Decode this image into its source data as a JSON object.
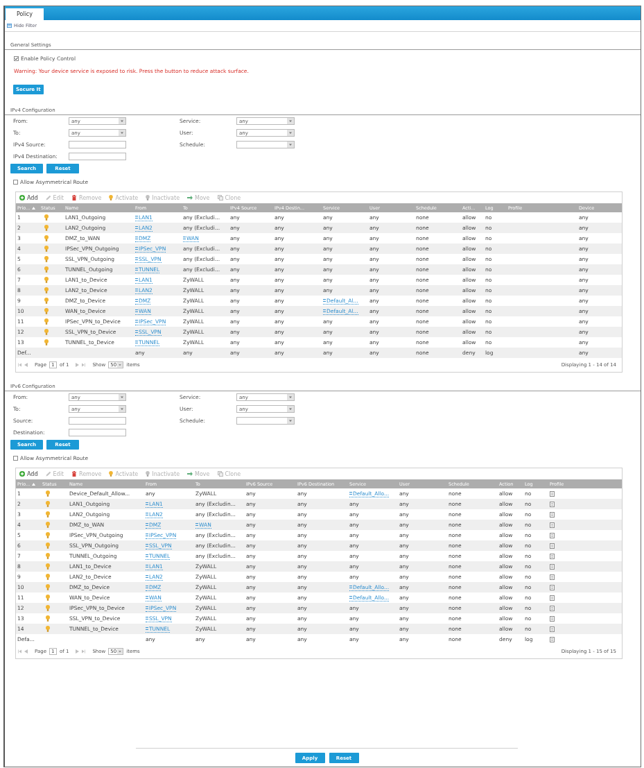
{
  "tabs": [
    {
      "label": "Policy",
      "selected": true
    }
  ],
  "filter_toggle": {
    "label": "Hide Filter"
  },
  "general_settings": {
    "title": "General Settings",
    "enable_policy_control": {
      "label": "Enable Policy Control",
      "checked": true
    },
    "warning": "Warning: Your device service is exposed to risk. Press the button to reduce attack surface.",
    "secure_button": "Secure It"
  },
  "ipv4": {
    "title": "IPv4 Configuration",
    "filters_left": [
      {
        "label": "From:",
        "kind": "select",
        "value": "any"
      },
      {
        "label": "To:",
        "kind": "select",
        "value": "any"
      },
      {
        "label": "IPv4 Source:",
        "kind": "text"
      },
      {
        "label": "IPv4 Destination:",
        "kind": "text"
      }
    ],
    "filters_right": [
      {
        "label": "Service:",
        "kind": "select",
        "value": "any"
      },
      {
        "label": "User:",
        "kind": "select",
        "value": "any"
      },
      {
        "label": "Schedule:",
        "kind": "select"
      }
    ],
    "buttons": [
      "Search",
      "Reset"
    ],
    "asymmetrical_route": {
      "label": "Allow Asymmetrical Route",
      "checked": false
    },
    "toolbar": [
      {
        "kind": "add",
        "label": "Add",
        "disabled": false
      },
      {
        "kind": "edit",
        "label": "Edit",
        "disabled": true
      },
      {
        "kind": "remove",
        "label": "Remove",
        "disabled": true
      },
      {
        "kind": "activate",
        "label": "Activate",
        "disabled": true
      },
      {
        "kind": "inactivate",
        "label": "Inactivate",
        "disabled": true
      },
      {
        "kind": "move",
        "label": "Move",
        "disabled": true
      },
      {
        "kind": "clone",
        "label": "Clone",
        "disabled": true
      }
    ],
    "table": {
      "columns": [
        {
          "label": "Prio...",
          "sorted": true
        },
        {
          "label": "Status",
          "sorted": false
        },
        {
          "label": "Name",
          "sorted": false
        },
        {
          "label": "From",
          "sorted": false
        },
        {
          "label": "To",
          "sorted": false
        },
        {
          "label": "IPv4 Source",
          "sorted": false
        },
        {
          "label": "IPv4 Destin...",
          "sorted": false
        },
        {
          "label": "Service",
          "sorted": false
        },
        {
          "label": "User",
          "sorted": false
        },
        {
          "label": "Schedule",
          "sorted": false
        },
        {
          "label": "Acti...",
          "sorted": false
        },
        {
          "label": "Log",
          "sorted": false
        },
        {
          "label": "Profile",
          "sorted": false
        },
        {
          "label": "Device",
          "sorted": false
        }
      ],
      "rows": [
        {
          "priority": "1",
          "active": true,
          "name": "LAN1_Outgoing",
          "from": {
            "kind": "object",
            "text": "LAN1"
          },
          "to": "any (Excludi...",
          "source": "any",
          "destination": "any",
          "service": "any",
          "user": "any",
          "schedule": "none",
          "action": "allow",
          "log": "no",
          "device": "any"
        },
        {
          "priority": "2",
          "active": true,
          "name": "LAN2_Outgoing",
          "from": {
            "kind": "object",
            "text": "LAN2"
          },
          "to": "any (Excludi...",
          "source": "any",
          "destination": "any",
          "service": "any",
          "user": "any",
          "schedule": "none",
          "action": "allow",
          "log": "no",
          "device": "any"
        },
        {
          "priority": "3",
          "active": true,
          "name": "DMZ_to_WAN",
          "from": {
            "kind": "object",
            "text": "DMZ"
          },
          "to": {
            "kind": "object",
            "text": "WAN"
          },
          "source": "any",
          "destination": "any",
          "service": "any",
          "user": "any",
          "schedule": "none",
          "action": "allow",
          "log": "no",
          "device": "any"
        },
        {
          "priority": "4",
          "active": true,
          "name": "IPSec_VPN_Outgoing",
          "from": {
            "kind": "object",
            "text": "IPSec_VPN"
          },
          "to": "any (Excludi...",
          "source": "any",
          "destination": "any",
          "service": "any",
          "user": "any",
          "schedule": "none",
          "action": "allow",
          "log": "no",
          "device": "any"
        },
        {
          "priority": "5",
          "active": true,
          "name": "SSL_VPN_Outgoing",
          "from": {
            "kind": "object",
            "text": "SSL_VPN"
          },
          "to": "any (Excludi...",
          "source": "any",
          "destination": "any",
          "service": "any",
          "user": "any",
          "schedule": "none",
          "action": "allow",
          "log": "no",
          "device": "any"
        },
        {
          "priority": "6",
          "active": true,
          "name": "TUNNEL_Outgoing",
          "from": {
            "kind": "object",
            "text": "TUNNEL"
          },
          "to": "any (Excludi...",
          "source": "any",
          "destination": "any",
          "service": "any",
          "user": "any",
          "schedule": "none",
          "action": "allow",
          "log": "no",
          "device": "any"
        },
        {
          "priority": "7",
          "active": true,
          "name": "LAN1_to_Device",
          "from": {
            "kind": "object",
            "text": "LAN1"
          },
          "to": "ZyWALL",
          "source": "any",
          "destination": "any",
          "service": "any",
          "user": "any",
          "schedule": "none",
          "action": "allow",
          "log": "no",
          "device": "any"
        },
        {
          "priority": "8",
          "active": true,
          "name": "LAN2_to_Device",
          "from": {
            "kind": "object",
            "text": "LAN2"
          },
          "to": "ZyWALL",
          "source": "any",
          "destination": "any",
          "service": "any",
          "user": "any",
          "schedule": "none",
          "action": "allow",
          "log": "no",
          "device": "any"
        },
        {
          "priority": "9",
          "active": true,
          "name": "DMZ_to_Device",
          "from": {
            "kind": "object",
            "text": "DMZ"
          },
          "to": "ZyWALL",
          "source": "any",
          "destination": "any",
          "service": {
            "kind": "object",
            "text": "Default_Al..."
          },
          "user": "any",
          "schedule": "none",
          "action": "allow",
          "log": "no",
          "device": "any"
        },
        {
          "priority": "10",
          "active": true,
          "name": "WAN_to_Device",
          "from": {
            "kind": "object",
            "text": "WAN"
          },
          "to": "ZyWALL",
          "source": "any",
          "destination": "any",
          "service": {
            "kind": "object",
            "text": "Default_Al..."
          },
          "user": "any",
          "schedule": "none",
          "action": "allow",
          "log": "no",
          "device": "any"
        },
        {
          "priority": "11",
          "active": true,
          "name": "IPSec_VPN_to_Device",
          "from": {
            "kind": "object",
            "text": "IPSec_VPN"
          },
          "to": "ZyWALL",
          "source": "any",
          "destination": "any",
          "service": "any",
          "user": "any",
          "schedule": "none",
          "action": "allow",
          "log": "no",
          "device": "any"
        },
        {
          "priority": "12",
          "active": true,
          "name": "SSL_VPN_to_Device",
          "from": {
            "kind": "object",
            "text": "SSL_VPN"
          },
          "to": "ZyWALL",
          "source": "any",
          "destination": "any",
          "service": "any",
          "user": "any",
          "schedule": "none",
          "action": "allow",
          "log": "no",
          "device": "any"
        },
        {
          "priority": "13",
          "active": true,
          "name": "TUNNEL_to_Device",
          "from": {
            "kind": "object",
            "text": "TUNNEL"
          },
          "to": "ZyWALL",
          "source": "any",
          "destination": "any",
          "service": "any",
          "user": "any",
          "schedule": "none",
          "action": "allow",
          "log": "no",
          "device": "any"
        },
        {
          "priority": "Def...",
          "active": false,
          "from": "any",
          "to": "any",
          "source": "any",
          "destination": "any",
          "service": "any",
          "user": "any",
          "schedule": "none",
          "action": "deny",
          "log": "log",
          "device": "any"
        }
      ]
    },
    "pagination": {
      "page_label": "Page",
      "page": "1",
      "page_count": "of 1",
      "show_label": "Show",
      "page_size": "50",
      "items_label": "items",
      "summary": "Displaying 1 - 14 of 14"
    }
  },
  "ipv6": {
    "title": "IPv6 Configuration",
    "filters_left": [
      {
        "label": "From:",
        "kind": "select",
        "value": "any"
      },
      {
        "label": "To:",
        "kind": "select",
        "value": "any"
      },
      {
        "label": "Source:",
        "kind": "text"
      },
      {
        "label": "Destination:",
        "kind": "text"
      }
    ],
    "filters_right": [
      {
        "label": "Service:",
        "kind": "select",
        "value": "any"
      },
      {
        "label": "User:",
        "kind": "select",
        "value": "any"
      },
      {
        "label": "Schedule:",
        "kind": "select"
      }
    ],
    "buttons": [
      "Search",
      "Reset"
    ],
    "asymmetrical_route": {
      "label": "Allow Asymmetrical Route",
      "checked": false
    },
    "toolbar": [
      {
        "kind": "add",
        "label": "Add",
        "disabled": false
      },
      {
        "kind": "edit",
        "label": "Edit",
        "disabled": true
      },
      {
        "kind": "remove",
        "label": "Remove",
        "disabled": true
      },
      {
        "kind": "activate",
        "label": "Activate",
        "disabled": true
      },
      {
        "kind": "inactivate",
        "label": "Inactivate",
        "disabled": true
      },
      {
        "kind": "move",
        "label": "Move",
        "disabled": true
      },
      {
        "kind": "clone",
        "label": "Clone",
        "disabled": true
      }
    ],
    "table": {
      "columns": [
        {
          "label": "Prio...",
          "sorted": true
        },
        {
          "label": "Status",
          "sorted": false
        },
        {
          "label": "Name",
          "sorted": false
        },
        {
          "label": "From",
          "sorted": false
        },
        {
          "label": "To",
          "sorted": false
        },
        {
          "label": "IPv6 Source",
          "sorted": false
        },
        {
          "label": "IPv6 Destination",
          "sorted": false
        },
        {
          "label": "Service",
          "sorted": false
        },
        {
          "label": "User",
          "sorted": false
        },
        {
          "label": "Schedule",
          "sorted": false
        },
        {
          "label": "Action",
          "sorted": false
        },
        {
          "label": "Log",
          "sorted": false
        },
        {
          "label": "Profile",
          "sorted": false
        }
      ],
      "rows": [
        {
          "priority": "1",
          "active": true,
          "name": "Device_Default_Allow...",
          "from": "any",
          "to": "ZyWALL",
          "source": "any",
          "destination": "any",
          "service": {
            "kind": "object",
            "text": "Default_Allo..."
          },
          "user": "any",
          "schedule": "none",
          "action": "allow",
          "log": "no",
          "profile": {
            "kind": "icon"
          }
        },
        {
          "priority": "2",
          "active": true,
          "name": "LAN1_Outgoing",
          "from": {
            "kind": "object",
            "text": "LAN1"
          },
          "to": "any (Excludin...",
          "source": "any",
          "destination": "any",
          "service": "any",
          "user": "any",
          "schedule": "none",
          "action": "allow",
          "log": "no",
          "profile": {
            "kind": "icon"
          }
        },
        {
          "priority": "3",
          "active": true,
          "name": "LAN2_Outgoing",
          "from": {
            "kind": "object",
            "text": "LAN2"
          },
          "to": "any (Excludin...",
          "source": "any",
          "destination": "any",
          "service": "any",
          "user": "any",
          "schedule": "none",
          "action": "allow",
          "log": "no",
          "profile": {
            "kind": "icon"
          }
        },
        {
          "priority": "4",
          "active": true,
          "name": "DMZ_to_WAN",
          "from": {
            "kind": "object",
            "text": "DMZ"
          },
          "to": {
            "kind": "object",
            "text": "WAN"
          },
          "source": "any",
          "destination": "any",
          "service": "any",
          "user": "any",
          "schedule": "none",
          "action": "allow",
          "log": "no",
          "profile": {
            "kind": "icon"
          }
        },
        {
          "priority": "5",
          "active": true,
          "name": "IPSec_VPN_Outgoing",
          "from": {
            "kind": "object",
            "text": "IPSec_VPN"
          },
          "to": "any (Excludin...",
          "source": "any",
          "destination": "any",
          "service": "any",
          "user": "any",
          "schedule": "none",
          "action": "allow",
          "log": "no",
          "profile": {
            "kind": "icon"
          }
        },
        {
          "priority": "6",
          "active": true,
          "name": "SSL_VPN_Outgoing",
          "from": {
            "kind": "object",
            "text": "SSL_VPN"
          },
          "to": "any (Excludin...",
          "source": "any",
          "destination": "any",
          "service": "any",
          "user": "any",
          "schedule": "none",
          "action": "allow",
          "log": "no",
          "profile": {
            "kind": "icon"
          }
        },
        {
          "priority": "7",
          "active": true,
          "name": "TUNNEL_Outgoing",
          "from": {
            "kind": "object",
            "text": "TUNNEL"
          },
          "to": "any (Excludin...",
          "source": "any",
          "destination": "any",
          "service": "any",
          "user": "any",
          "schedule": "none",
          "action": "allow",
          "log": "no",
          "profile": {
            "kind": "icon"
          }
        },
        {
          "priority": "8",
          "active": true,
          "name": "LAN1_to_Device",
          "from": {
            "kind": "object",
            "text": "LAN1"
          },
          "to": "ZyWALL",
          "source": "any",
          "destination": "any",
          "service": "any",
          "user": "any",
          "schedule": "none",
          "action": "allow",
          "log": "no",
          "profile": {
            "kind": "icon"
          }
        },
        {
          "priority": "9",
          "active": true,
          "name": "LAN2_to_Device",
          "from": {
            "kind": "object",
            "text": "LAN2"
          },
          "to": "ZyWALL",
          "source": "any",
          "destination": "any",
          "service": "any",
          "user": "any",
          "schedule": "none",
          "action": "allow",
          "log": "no",
          "profile": {
            "kind": "icon"
          }
        },
        {
          "priority": "10",
          "active": true,
          "name": "DMZ_to_Device",
          "from": {
            "kind": "object",
            "text": "DMZ"
          },
          "to": "ZyWALL",
          "source": "any",
          "destination": "any",
          "service": {
            "kind": "object",
            "text": "Default_Allo..."
          },
          "user": "any",
          "schedule": "none",
          "action": "allow",
          "log": "no",
          "profile": {
            "kind": "icon"
          }
        },
        {
          "priority": "11",
          "active": true,
          "name": "WAN_to_Device",
          "from": {
            "kind": "object",
            "text": "WAN"
          },
          "to": "ZyWALL",
          "source": "any",
          "destination": "any",
          "service": {
            "kind": "object",
            "text": "Default_Allo..."
          },
          "user": "any",
          "schedule": "none",
          "action": "allow",
          "log": "no",
          "profile": {
            "kind": "icon"
          }
        },
        {
          "priority": "12",
          "active": true,
          "name": "IPSec_VPN_to_Device",
          "from": {
            "kind": "object",
            "text": "IPSec_VPN"
          },
          "to": "ZyWALL",
          "source": "any",
          "destination": "any",
          "service": "any",
          "user": "any",
          "schedule": "none",
          "action": "allow",
          "log": "no",
          "profile": {
            "kind": "icon"
          }
        },
        {
          "priority": "13",
          "active": true,
          "name": "SSL_VPN_to_Device",
          "from": {
            "kind": "object",
            "text": "SSL_VPN"
          },
          "to": "ZyWALL",
          "source": "any",
          "destination": "any",
          "service": "any",
          "user": "any",
          "schedule": "none",
          "action": "allow",
          "log": "no",
          "profile": {
            "kind": "icon"
          }
        },
        {
          "priority": "14",
          "active": true,
          "name": "TUNNEL_to_Device",
          "from": {
            "kind": "object",
            "text": "TUNNEL"
          },
          "to": "ZyWALL",
          "source": "any",
          "destination": "any",
          "service": "any",
          "user": "any",
          "schedule": "none",
          "action": "allow",
          "log": "no",
          "profile": {
            "kind": "icon"
          }
        },
        {
          "priority": "Defa...",
          "active": false,
          "from": "any",
          "to": "any",
          "source": "any",
          "destination": "any",
          "service": "any",
          "user": "any",
          "schedule": "none",
          "action": "deny",
          "log": "log",
          "profile": {
            "kind": "icon"
          }
        }
      ]
    },
    "pagination": {
      "page_label": "Page",
      "page": "1",
      "page_count": "of 1",
      "show_label": "Show",
      "page_size": "50",
      "items_label": "items",
      "summary": "Displaying 1 - 15 of 15"
    }
  },
  "footer_buttons": [
    "Apply",
    "Reset"
  ]
}
